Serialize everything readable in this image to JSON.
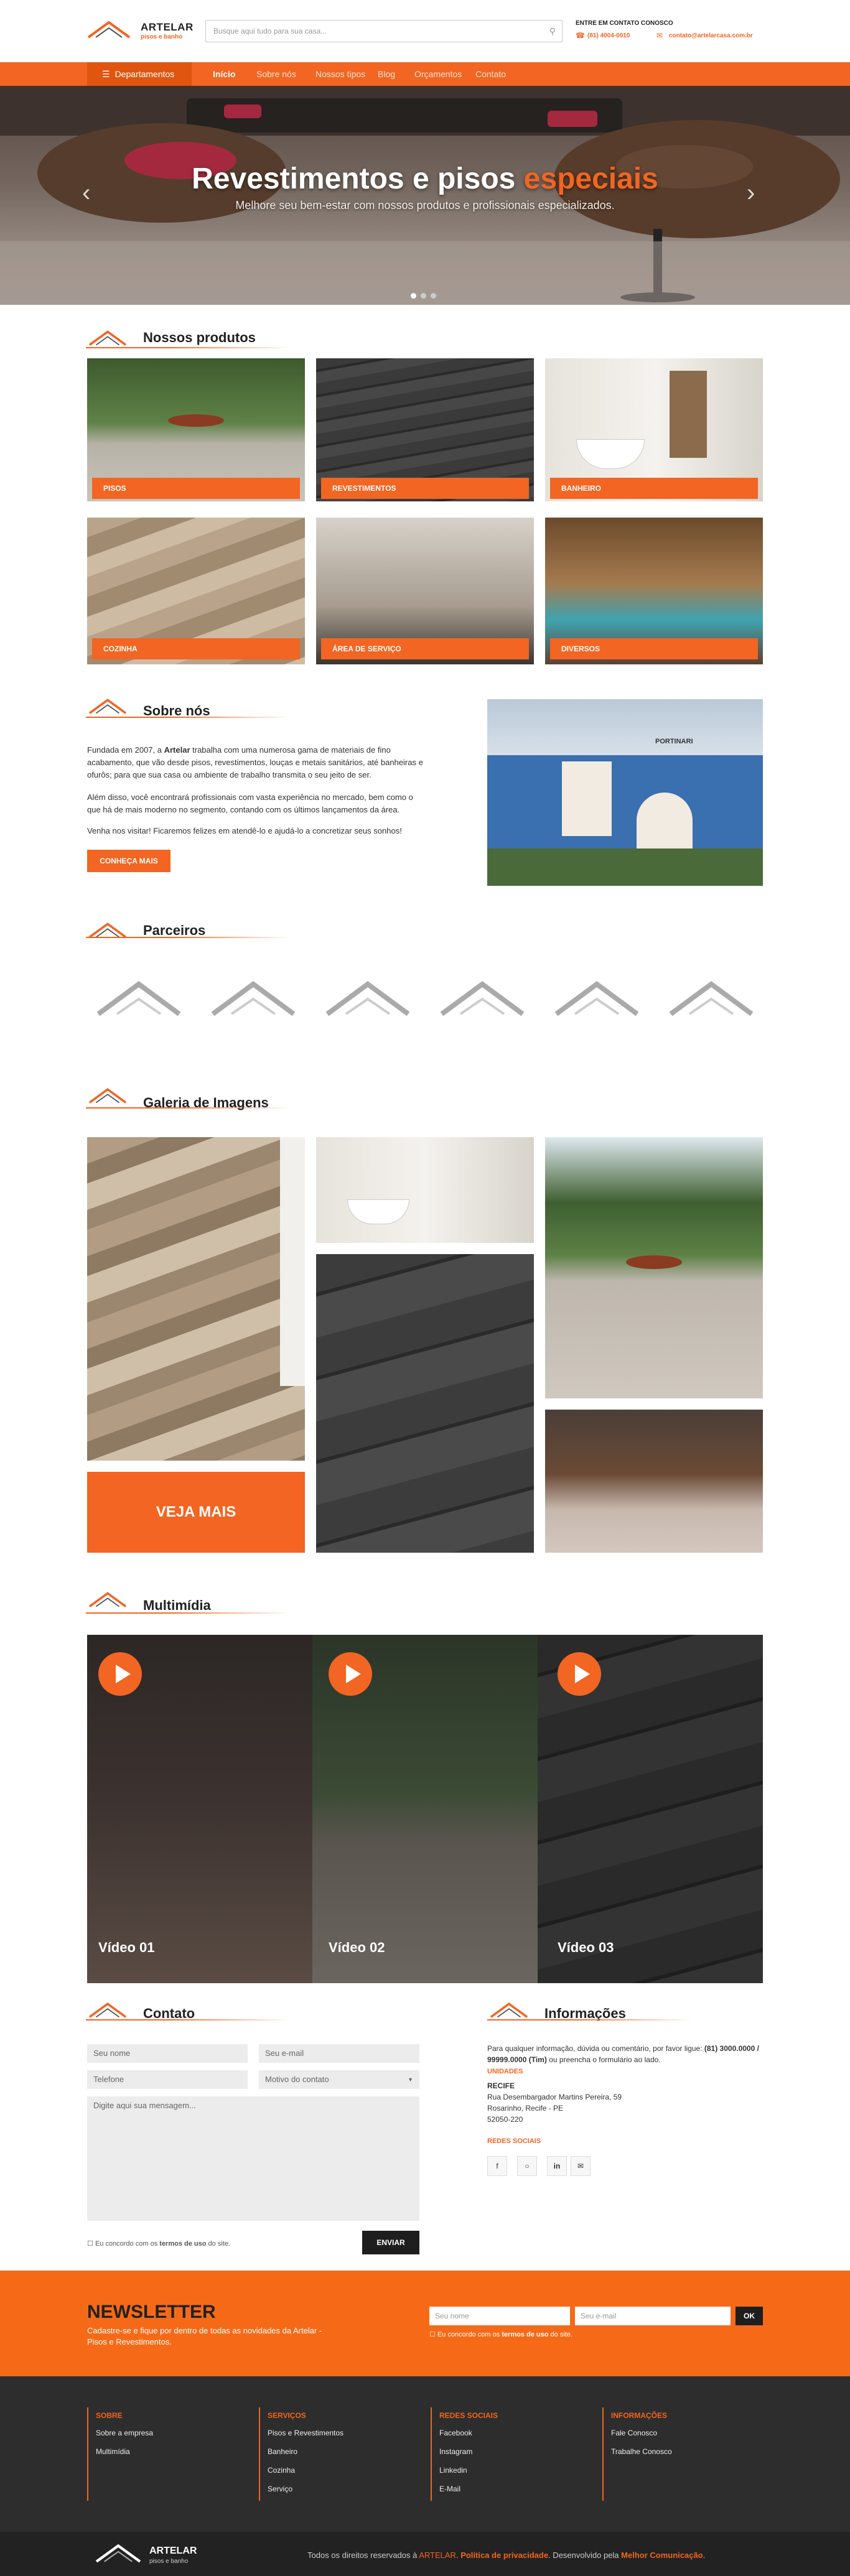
{
  "header": {
    "brand": "ARTELAR",
    "brand_sub": "pisos e banho",
    "search_placeholder": "Busque aqui tudo para sua casa...",
    "contact_heading": "ENTRE EM CONTATO CONOSCO",
    "phone": "(81) 4004-0010",
    "email": "contato@artelarcasa.com.br"
  },
  "nav": {
    "departments": "Departamentos",
    "items": [
      "Início",
      "Sobre nós",
      "Nossos tipos",
      "Blog",
      "Orçamentos",
      "Contato"
    ]
  },
  "hero": {
    "title_part1": "Revestimentos e pisos ",
    "title_part2": "especiais",
    "subtitle": "Melhore seu bem-estar com nossos produtos e profissionais especializados."
  },
  "products": {
    "title": "Nossos produtos",
    "items": [
      "PISOS",
      "REVESTIMENTOS",
      "BANHEIRO",
      "COZINHA",
      "ÁREA DE SERVIÇO",
      "DIVERSOS"
    ]
  },
  "about": {
    "title": "Sobre nós",
    "p1a": "Fundada em 2007, a ",
    "p1b": "Artelar",
    "p1c": " trabalha com uma numerosa gama de materiais de fino acabamento, que vão desde pisos, revestimentos, louças e metais sanitários, até banheiras e ofurôs; para que sua casa ou ambiente de trabalho transmita o seu jeito de ser.",
    "p2": "Além disso, você encontrará profissionais com vasta experiência no mercado, bem como o que há de mais moderno no segmento, contando com os últimos lançamentos da área.",
    "p3": "Venha nos visitar! Ficaremos felizes em atendê-lo e ajudá-lo a concretizar seus sonhos!",
    "button": "CONHEÇA MAIS",
    "store_sign": "PORTINARI"
  },
  "partners": {
    "title": "Parceiros"
  },
  "gallery": {
    "title": "Galeria de Imagens",
    "button": "VEJA MAIS"
  },
  "multimedia": {
    "title": "Multimídia",
    "videos": [
      "Vídeo 01",
      "Vídeo 02",
      "Vídeo 03"
    ]
  },
  "contact": {
    "title": "Contato",
    "name": "Seu nome",
    "email": "Seu e-mail",
    "phone": "Telefone",
    "reason": "Motivo do contato",
    "message": "Digite aqui sua mensagem...",
    "agree_a": "Eu concordo com os ",
    "agree_b": "termos de uso",
    "agree_c": " do site.",
    "send": "ENVIAR"
  },
  "info": {
    "title": "Informações",
    "intro_a": "Para qualquer informação, dúvida ou comentário, por favor ligue: ",
    "intro_b": "(81) 3000.0000 / 99999.0000 (Tim)",
    "intro_c": " ou preencha o formulário ao lado.",
    "units_head": "UNIDADES",
    "city": "RECIFE",
    "address": [
      "Rua Desembargador Martins Pereira, 59",
      "Rosarinho, Recife - PE",
      "52050-220"
    ],
    "social_head": "REDES SOCIAIS"
  },
  "newsletter": {
    "title": "NEWSLETTER",
    "text": "Cadastre-se e fique por dentro de todas as novidades da Artelar - Pisos e Revestimentos.",
    "name": "Seu nome",
    "email": "Seu e-mail",
    "ok": "OK",
    "agree_a": "Eu concordo com os ",
    "agree_b": "termos de uso",
    "agree_c": " do site."
  },
  "footer": {
    "cols": [
      {
        "head": "SOBRE",
        "items": [
          "Sobre a empresa",
          "Multimídia"
        ]
      },
      {
        "head": "SERVIÇOS",
        "items": [
          "Pisos e Revestimentos",
          "Banheiro",
          "Cozinha",
          "Serviço"
        ]
      },
      {
        "head": "REDES SOCIAIS",
        "items": [
          "Facebook",
          "Instagram",
          "Linkedin",
          "E-Mail"
        ]
      },
      {
        "head": "INFORMAÇÕES",
        "items": [
          "Fale Conosco",
          "Trabalhe Conosco"
        ]
      }
    ],
    "copy_a": "Todos os direitos reservados à ",
    "copy_b": "ARTELAR",
    "copy_c": ". ",
    "copy_d": "Política de privacidade",
    "copy_e": ". Desenvolvido pela ",
    "copy_f": "Melhor Comunicação",
    "copy_g": "."
  },
  "colors": {
    "accent": "#f26522",
    "dark": "#2d2d2d"
  }
}
